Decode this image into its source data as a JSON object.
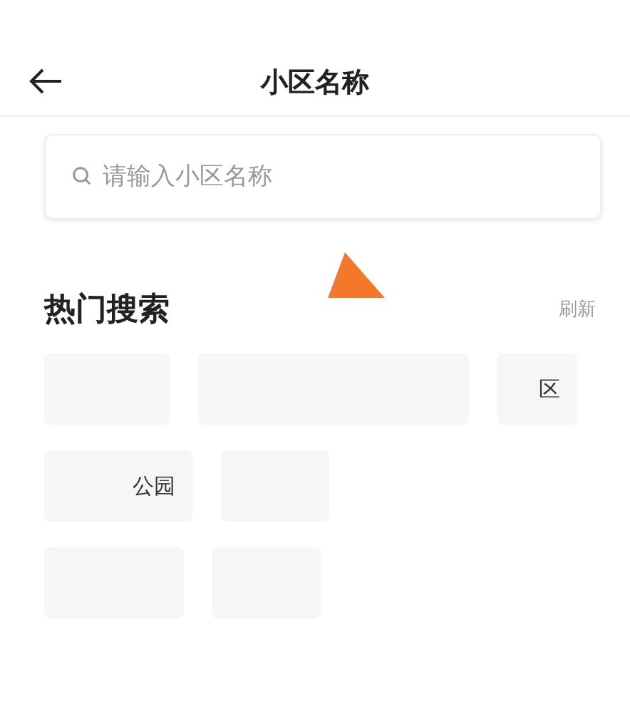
{
  "header": {
    "title": "小区名称"
  },
  "search": {
    "placeholder": "请输入小区名称"
  },
  "hot_search": {
    "title": "热门搜索",
    "refresh": "刷新",
    "rows": [
      {
        "chips": [
          {
            "kind": "blank"
          },
          {
            "kind": "blank"
          },
          {
            "kind": "text",
            "text": "区"
          }
        ]
      },
      {
        "chips": [
          {
            "kind": "text",
            "text": "公园"
          },
          {
            "kind": "blank"
          }
        ]
      },
      {
        "chips": [
          {
            "kind": "blank"
          },
          {
            "kind": "blank"
          }
        ]
      }
    ]
  }
}
